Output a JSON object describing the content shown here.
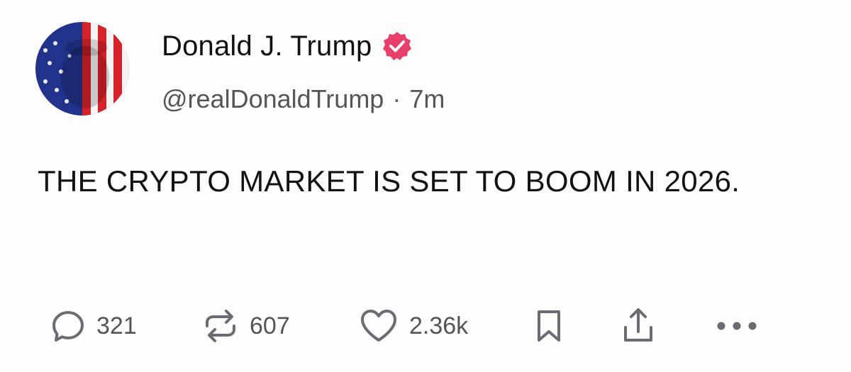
{
  "post": {
    "author": {
      "display_name": "Donald J. Trump",
      "handle": "@realDonaldTrump",
      "verified": true,
      "avatar_icon": "flag-portrait-avatar"
    },
    "separator": "·",
    "timestamp": "7m",
    "text": "THE CRYPTO MARKET IS SET TO BOOM IN 2026."
  },
  "actions": {
    "reply": {
      "icon": "reply-icon",
      "count": "321"
    },
    "repost": {
      "icon": "repost-icon",
      "count": "607"
    },
    "like": {
      "icon": "heart-icon",
      "count": "2.36k"
    },
    "bookmark": {
      "icon": "bookmark-icon"
    },
    "share": {
      "icon": "share-icon"
    },
    "more": {
      "icon": "more-icon"
    }
  },
  "colors": {
    "verified_badge": "#e8406a",
    "icon_gray": "#6b6b72",
    "text_primary": "#121212",
    "text_secondary": "#555555"
  }
}
